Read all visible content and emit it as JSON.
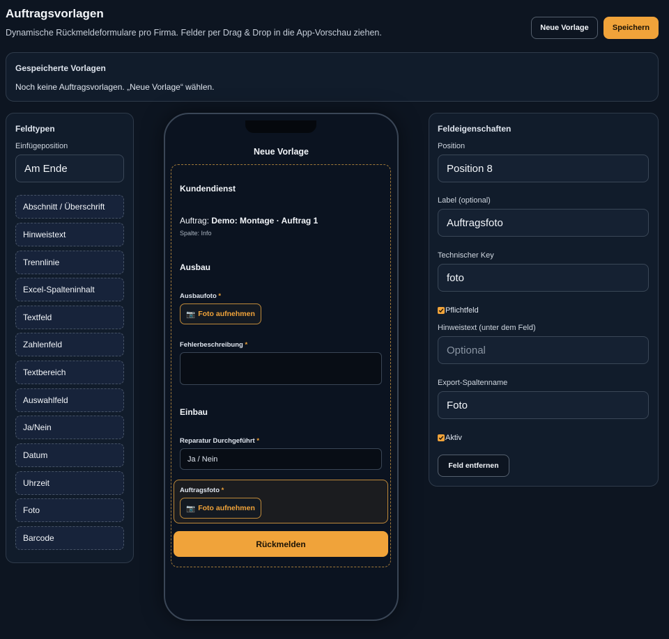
{
  "header": {
    "title": "Auftragsvorlagen",
    "subtitle": "Dynamische Rückmeldeformulare pro Firma. Felder per Drag & Drop in die App-Vorschau ziehen.",
    "new_label": "Neue Vorlage",
    "save_label": "Speichern"
  },
  "saved": {
    "title": "Gespeicherte Vorlagen",
    "empty_text": "Noch keine Auftragsvorlagen. „Neue Vorlage“ wählen."
  },
  "field_types": {
    "title": "Feldtypen",
    "insert_label": "Einfügeposition",
    "insert_value": "Am Ende",
    "items": [
      "Abschnitt / Überschrift",
      "Hinweistext",
      "Trennlinie",
      "Excel-Spalteninhalt",
      "Textfeld",
      "Zahlenfeld",
      "Textbereich",
      "Auswahlfeld",
      "Ja/Nein",
      "Datum",
      "Uhrzeit",
      "Foto",
      "Barcode"
    ]
  },
  "preview": {
    "title": "Neue Vorlage",
    "section1": "Kundendienst",
    "order_prefix": "Auftrag: ",
    "order_value": "Demo: Montage · Auftrag 1",
    "order_column": "Spalte: Info",
    "section2": "Ausbau",
    "field_ausbaufoto": "Ausbaufoto",
    "photo_button": "Foto aufnehmen",
    "field_fehler": "Fehlerbeschreibung",
    "section3": "Einbau",
    "field_reparatur": "Reparatur Durchgeführt",
    "reparatur_value": "Ja / Nein",
    "field_auftragsfoto": "Auftragsfoto",
    "required_mark": "*",
    "submit_label": "Rückmelden"
  },
  "properties": {
    "title": "Feldeigenschaften",
    "position_label": "Position",
    "position_value": "Position 8",
    "label_label": "Label (optional)",
    "label_value": "Auftragsfoto",
    "key_label": "Technischer Key",
    "key_value": "foto",
    "required_label": "Pflichtfeld",
    "hint_label": "Hinweistext (unter dem Feld)",
    "hint_placeholder": "Optional",
    "export_label": "Export-Spaltenname",
    "export_value": "Foto",
    "active_label": "Aktiv",
    "remove_label": "Feld entfernen"
  },
  "icons": {
    "camera": "camera-icon",
    "check": "checkmark-icon"
  },
  "colors": {
    "background": "#0d1521",
    "panel": "#111c2b",
    "accent": "#f0a33a"
  }
}
